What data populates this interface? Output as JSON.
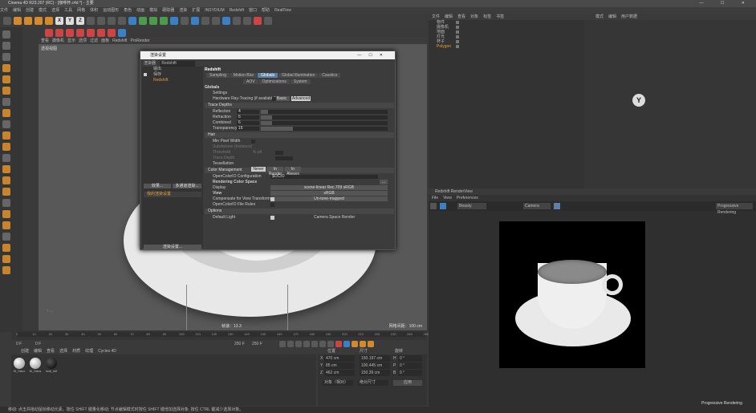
{
  "window": {
    "title": "Cinema 4D R23.207 (RC) - [咖啡杯.c4d *] - 主要",
    "controls": "—  ☐  ✕"
  },
  "menubar": [
    "文件",
    "编辑",
    "创建",
    "模式",
    "选择",
    "工具",
    "网格",
    "体积",
    "运动图形",
    "角色",
    "动画",
    "模拟",
    "跟踪器",
    "渲染",
    "扩展",
    "INSYDIUM",
    "Redshift",
    "窗口",
    "帮助",
    "RealFlow"
  ],
  "toolbar": {
    "axis": [
      "X",
      "Y",
      "Z"
    ]
  },
  "viewport": {
    "menu": [
      "查看",
      "摄像机",
      "显示",
      "选项",
      "过滤",
      "面板",
      "Redshift",
      "ProRender"
    ],
    "label": "透视视图",
    "grid_info": "网格间距：100 cm",
    "speed": "帧速：13.3"
  },
  "timeline": {
    "ticks": [
      "0",
      "10",
      "20",
      "30",
      "40",
      "50",
      "60",
      "70",
      "80",
      "90",
      "100",
      "110",
      "120",
      "130",
      "140",
      "150",
      "160",
      "170",
      "180",
      "190",
      "200",
      "210",
      "220",
      "230",
      "240",
      "250"
    ],
    "frame_start": "0 F",
    "frame_current": "0 F",
    "frame_max": "250 F",
    "frame_end": "250 F",
    "frame_display": "0 F"
  },
  "materials": {
    "tabs": [
      "创建",
      "编辑",
      "查看",
      "选择",
      "材质",
      "纹理",
      "Cycles 4D"
    ],
    "items": [
      "M_Sauc",
      "M_Saus",
      "mat_sel"
    ]
  },
  "coords": {
    "headers": [
      "位置",
      "尺寸",
      "旋转"
    ],
    "rows": [
      {
        "axis": "X",
        "pos": "470 cm",
        "size": "150.197 cm",
        "rot": "H",
        "rval": "0 °"
      },
      {
        "axis": "Y",
        "pos": "85 cm",
        "size": "100.445 cm",
        "rot": "P",
        "rval": "0 °"
      },
      {
        "axis": "Z",
        "pos": "462 cm",
        "size": "150.39 cm",
        "rot": "B",
        "rval": "0 °"
      }
    ],
    "mode": "对象（相对）",
    "size_mode": "绝对尺寸",
    "apply": "应用"
  },
  "objects": {
    "menu": [
      "文件",
      "编辑",
      "查看",
      "对象",
      "标签",
      "书签"
    ],
    "items": [
      "物件",
      "摄像机",
      "地面",
      "灯光",
      "杯子",
      "Polygon"
    ]
  },
  "attributes": {
    "menu": [
      "模式",
      "编辑",
      "用户数据"
    ]
  },
  "renderview": {
    "title": "Redshift RenderView",
    "menu": [
      "File",
      "View",
      "Preferences"
    ],
    "mode": "Beauty",
    "camera": "Camera",
    "preset": "Progressive Rendering"
  },
  "dialog": {
    "title": "渲染设置",
    "renderer_label": "渲染器",
    "renderer_value": "Redshift",
    "side_items": [
      "输出",
      "保存",
      "Redshift"
    ],
    "side_effect_btn": "效果...",
    "side_multi_btn": "多通道渲染...",
    "side_settings": "我的渲染设置",
    "side_render_btn": "渲染设置...",
    "header": "Redshift",
    "tabs_row1": [
      "Sampling",
      "Motion Blur",
      "Globals",
      "Global Illumination",
      "Caustics"
    ],
    "tabs_row2": [
      "AOV",
      "Optimizations",
      "System"
    ],
    "section_globals": "Globals",
    "settings_label": "Settings",
    "settings_basic": "Basic",
    "settings_advanced": "Advanced",
    "hw_rt_label": "Hardware Ray-Tracing (if available)",
    "trace_depths": "Trace Depths",
    "depths": [
      {
        "label": "Reflection",
        "value": "4",
        "frac": 0.06
      },
      {
        "label": "Refraction",
        "value": "6",
        "frac": 0.09
      },
      {
        "label": "Combined",
        "value": "6",
        "frac": 0.09
      },
      {
        "label": "Transparency",
        "value": "16",
        "frac": 0.25
      }
    ],
    "hair": "Hair",
    "hair_rows": [
      "Min Pixel Width",
      "Subdivision (Instance)",
      "Threshold",
      "Trace Depth"
    ],
    "hair_unit": "% ptl",
    "tess_label": "Tessellation",
    "tess_never": "Never",
    "tess_render": "In Render",
    "tess_always": "In Always",
    "color_mgmt": "Color Management",
    "ocio_label": "OpenColorIO Configuration",
    "ocio_value": "$OCIO",
    "rendering_cs": "Rendering Color Space",
    "rendering_cs_value": "scene-linear Rec.709 sRGB",
    "display_label": "Display",
    "display_value": "sRGB",
    "view_label": "View",
    "view_value": "Un-tone-mapped",
    "comp_label": "Compensate for View Transform",
    "ocio_rules": "OpenColorIO File Rules",
    "options": "Options",
    "default_light": "Default Light",
    "camera_space": "Camera Space Render"
  },
  "statusbar": "移动: 点击并拖动鼠标移动元素。按住 SHIFT 键量化移动; 节点编辑模式时按住 SHIFT 键增加选择对象; 按住 CTRL 键减少选择对象。",
  "colors": {
    "accent": "#5d7fa8",
    "orange": "#d48a2c"
  }
}
